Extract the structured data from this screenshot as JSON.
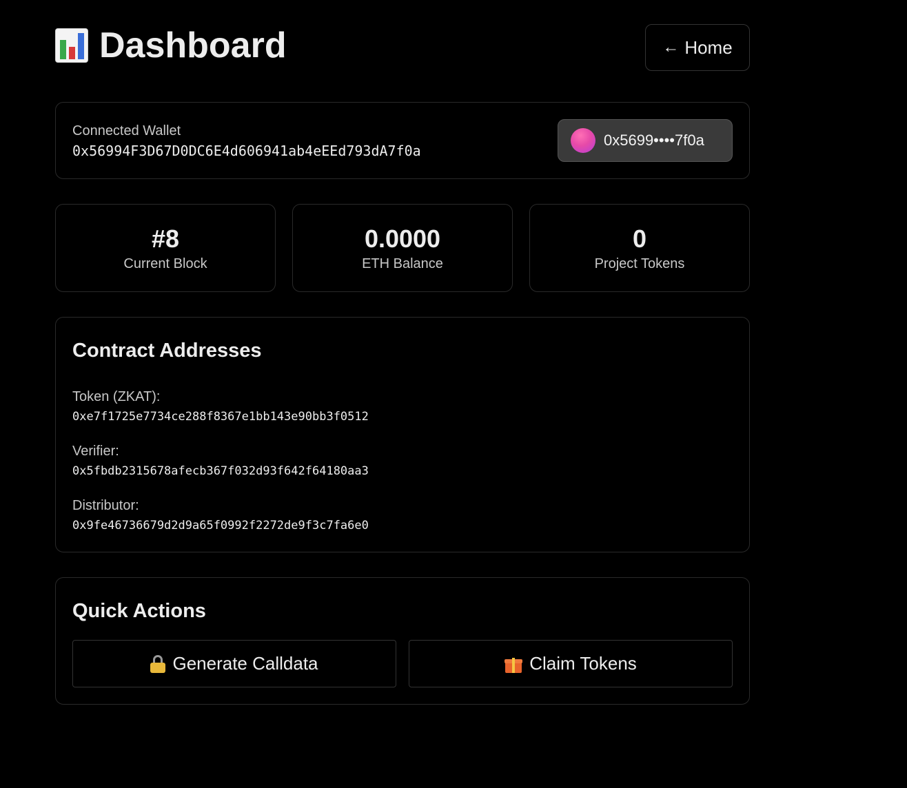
{
  "header": {
    "title": "Dashboard",
    "title_icon": "bar-chart-icon",
    "home_button": {
      "arrow": "←",
      "label": "Home"
    }
  },
  "wallet": {
    "label": "Connected Wallet",
    "address": "0x56994F3D67D0DC6E4d606941ab4eEEd793dA7f0a",
    "chip_text": "0x5699••••7f0a"
  },
  "stats": [
    {
      "value": "#8",
      "label": "Current Block"
    },
    {
      "value": "0.0000",
      "label": "ETH Balance"
    },
    {
      "value": "0",
      "label": "Project Tokens"
    }
  ],
  "contracts": {
    "title": "Contract Addresses",
    "items": [
      {
        "label": "Token (ZKAT):",
        "address": "0xe7f1725e7734ce288f8367e1bb143e90bb3f0512"
      },
      {
        "label": "Verifier:",
        "address": "0x5fbdb2315678afecb367f032d93f642f64180aa3"
      },
      {
        "label": "Distributor:",
        "address": "0x9fe46736679d2d9a65f0992f2272de9f3c7fa6e0"
      }
    ]
  },
  "quick_actions": {
    "title": "Quick Actions",
    "buttons": [
      {
        "icon": "lock-with-key-icon",
        "label": "Generate Calldata"
      },
      {
        "icon": "gift-icon",
        "label": "Claim Tokens"
      }
    ]
  },
  "colors": {
    "background": "#000000",
    "border": "#2a2a2a",
    "text": "#ededed",
    "muted_text": "#c8c8c8",
    "chip_background": "#3a3a3a",
    "avatar_gradient_start": "#ff6fb5",
    "avatar_gradient_end": "#b83ed8"
  }
}
